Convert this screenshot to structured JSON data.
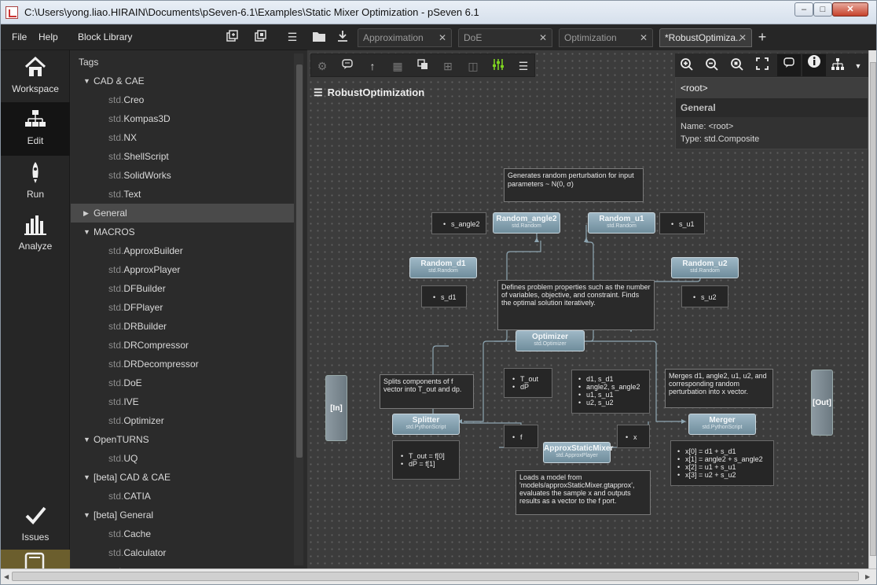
{
  "window": {
    "title": "C:\\Users\\yong.liao.HIRAIN\\Documents\\pSeven-6.1\\Examples\\Static Mixer Optimization - pSeven 6.1",
    "controls": {
      "minimize": "–",
      "maximize": "□",
      "close": "✕"
    }
  },
  "menu": {
    "file": "File",
    "help": "Help"
  },
  "library": {
    "title": "Block Library",
    "tags_label": "Tags",
    "rows": [
      {
        "kind": "cat",
        "expanded": true,
        "label": "CAD & CAE"
      },
      {
        "kind": "leaf",
        "ns": "std.",
        "label": "Creo"
      },
      {
        "kind": "leaf",
        "ns": "std.",
        "label": "Kompas3D"
      },
      {
        "kind": "leaf",
        "ns": "std.",
        "label": "NX"
      },
      {
        "kind": "leaf",
        "ns": "std.",
        "label": "ShellScript"
      },
      {
        "kind": "leaf",
        "ns": "std.",
        "label": "SolidWorks"
      },
      {
        "kind": "leaf",
        "ns": "std.",
        "label": "Text"
      },
      {
        "kind": "cat",
        "expanded": false,
        "label": "General",
        "selected": true
      },
      {
        "kind": "cat",
        "expanded": true,
        "label": "MACROS"
      },
      {
        "kind": "leaf",
        "ns": "std.",
        "label": "ApproxBuilder"
      },
      {
        "kind": "leaf",
        "ns": "std.",
        "label": "ApproxPlayer"
      },
      {
        "kind": "leaf",
        "ns": "std.",
        "label": "DFBuilder"
      },
      {
        "kind": "leaf",
        "ns": "std.",
        "label": "DFPlayer"
      },
      {
        "kind": "leaf",
        "ns": "std.",
        "label": "DRBuilder"
      },
      {
        "kind": "leaf",
        "ns": "std.",
        "label": "DRCompressor"
      },
      {
        "kind": "leaf",
        "ns": "std.",
        "label": "DRDecompressor"
      },
      {
        "kind": "leaf",
        "ns": "std.",
        "label": "DoE"
      },
      {
        "kind": "leaf",
        "ns": "std.",
        "label": "IVE"
      },
      {
        "kind": "leaf",
        "ns": "std.",
        "label": "Optimizer"
      },
      {
        "kind": "cat",
        "expanded": true,
        "label": "OpenTURNS"
      },
      {
        "kind": "leaf",
        "ns": "std.",
        "label": "UQ"
      },
      {
        "kind": "cat",
        "expanded": true,
        "label": "[beta] CAD & CAE"
      },
      {
        "kind": "leaf",
        "ns": "std.",
        "label": "CATIA"
      },
      {
        "kind": "cat",
        "expanded": true,
        "label": "[beta] General"
      },
      {
        "kind": "leaf",
        "ns": "std.",
        "label": "Cache"
      },
      {
        "kind": "leaf",
        "ns": "std.",
        "label": "Calculator"
      },
      {
        "kind": "leaf",
        "ns": "std.",
        "label": ""
      }
    ]
  },
  "nav": {
    "workspace": "Workspace",
    "edit": "Edit",
    "run": "Run",
    "analyze": "Analyze",
    "issues": "Issues"
  },
  "tabs": [
    {
      "label": "Approximation",
      "active": false
    },
    {
      "label": "DoE",
      "active": false
    },
    {
      "label": "Optimization",
      "active": false
    },
    {
      "label": "*RobustOptimiza..",
      "active": true
    }
  ],
  "canvas": {
    "title": "RobustOptimization",
    "properties": {
      "path": "<root>",
      "section": "General",
      "name_line": "Name: <root>",
      "type_line": "Type: std.Composite"
    },
    "blocks": {
      "random_angle2": {
        "name": "Random_angle2",
        "type": "std.Random"
      },
      "random_u1": {
        "name": "Random_u1",
        "type": "std.Random"
      },
      "random_d1": {
        "name": "Random_d1",
        "type": "std.Random"
      },
      "random_u2": {
        "name": "Random_u2",
        "type": "std.Random"
      },
      "optimizer": {
        "name": "Optimizer",
        "type": "std.Optimizer"
      },
      "splitter": {
        "name": "Splitter",
        "type": "std.PythonScript"
      },
      "merger": {
        "name": "Merger",
        "type": "std.PythonScript"
      },
      "approx": {
        "name": "ApproxStaticMixer",
        "type": "std.ApproxPlayer"
      },
      "in": "[In]",
      "out": "[Out]"
    },
    "ports": {
      "s_angle2": [
        "s_angle2"
      ],
      "s_u1": [
        "s_u1"
      ],
      "s_d1": [
        "s_d1"
      ],
      "s_u2": [
        "s_u2"
      ],
      "opt_out": [
        "T_out",
        "dP"
      ],
      "opt_in": [
        "d1, s_d1",
        "angle2, s_angle2",
        "u1, s_u1",
        "u2, s_u2"
      ],
      "f": [
        "f"
      ],
      "x": [
        "x"
      ],
      "splitter": [
        "T_out = f[0]",
        "dP = f[1]"
      ],
      "merger": [
        "x[0] = d1 + s_d1",
        "x[1] = angle2 + s_angle2",
        "x[2] = u1 + s_u1",
        "x[3] = u2 + s_u2"
      ]
    },
    "notes": {
      "random": "Generates random perturbation for input parameters ~ N(0, σ)",
      "optimizer": "Defines problem properties such as the number of variables, objective, and constraint. Finds the optimal solution iteratively.",
      "splitter": "Splits components of f vector into T_out and dp.",
      "merger": "Merges d1, angle2, u1, u2, and corresponding random perturbation into x vector.",
      "approx": "Loads a model from 'models/approxStaticMixer.gtapprox', evaluates the sample x and outputs results as a vector to the f port."
    }
  },
  "icons": {
    "new_block": "new-block-icon",
    "new_composite": "new-composite-icon",
    "menu": "hamburger-menu-icon",
    "open": "open-folder-icon",
    "save": "download-icon",
    "add_tab": "plus-icon"
  }
}
